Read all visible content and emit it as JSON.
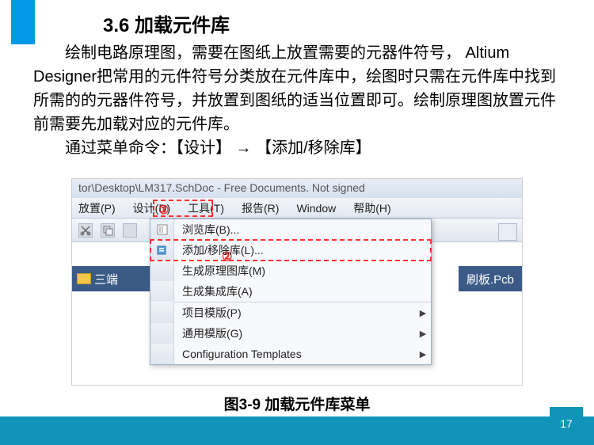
{
  "heading": "3.6 加载元件库",
  "paragraph1": "绘制电路原理图，需要在图纸上放置需要的元器件符号， Altium Designer把常用的元件符号分类放在元件库中，绘图时只需在元件库中找到所需的的元器件符号，并放置到图纸的适当位置即可。绘制原理图放置元件前需要先加载对应的元件库。",
  "paragraph2": "通过菜单命令：【设计】 → 【添加/移除库】",
  "titlebar": "tor\\Desktop\\LM317.SchDoc - Free Documents. Not signed",
  "menubar": {
    "place": "放置(P)",
    "design": "设计(D)",
    "tools": "工具(T)",
    "report": "报告(R)",
    "window": "Window",
    "help": "帮助(H)"
  },
  "dropdown": {
    "browse": "浏览库(B)...",
    "addremove": "添加/移除库(L)...",
    "gensch": "生成原理图库(M)",
    "genint": "生成集成库(A)",
    "projtpl": "项目模版(P)",
    "gentpl": "通用模版(G)",
    "cfgtpl": "Configuration Templates"
  },
  "leftstrip": "三端",
  "rightstrip": "刷板.Pcb",
  "callouts": {
    "c1": "①",
    "c2": "②"
  },
  "caption": "图3-9    加载元件库菜单",
  "pagenum": "17"
}
